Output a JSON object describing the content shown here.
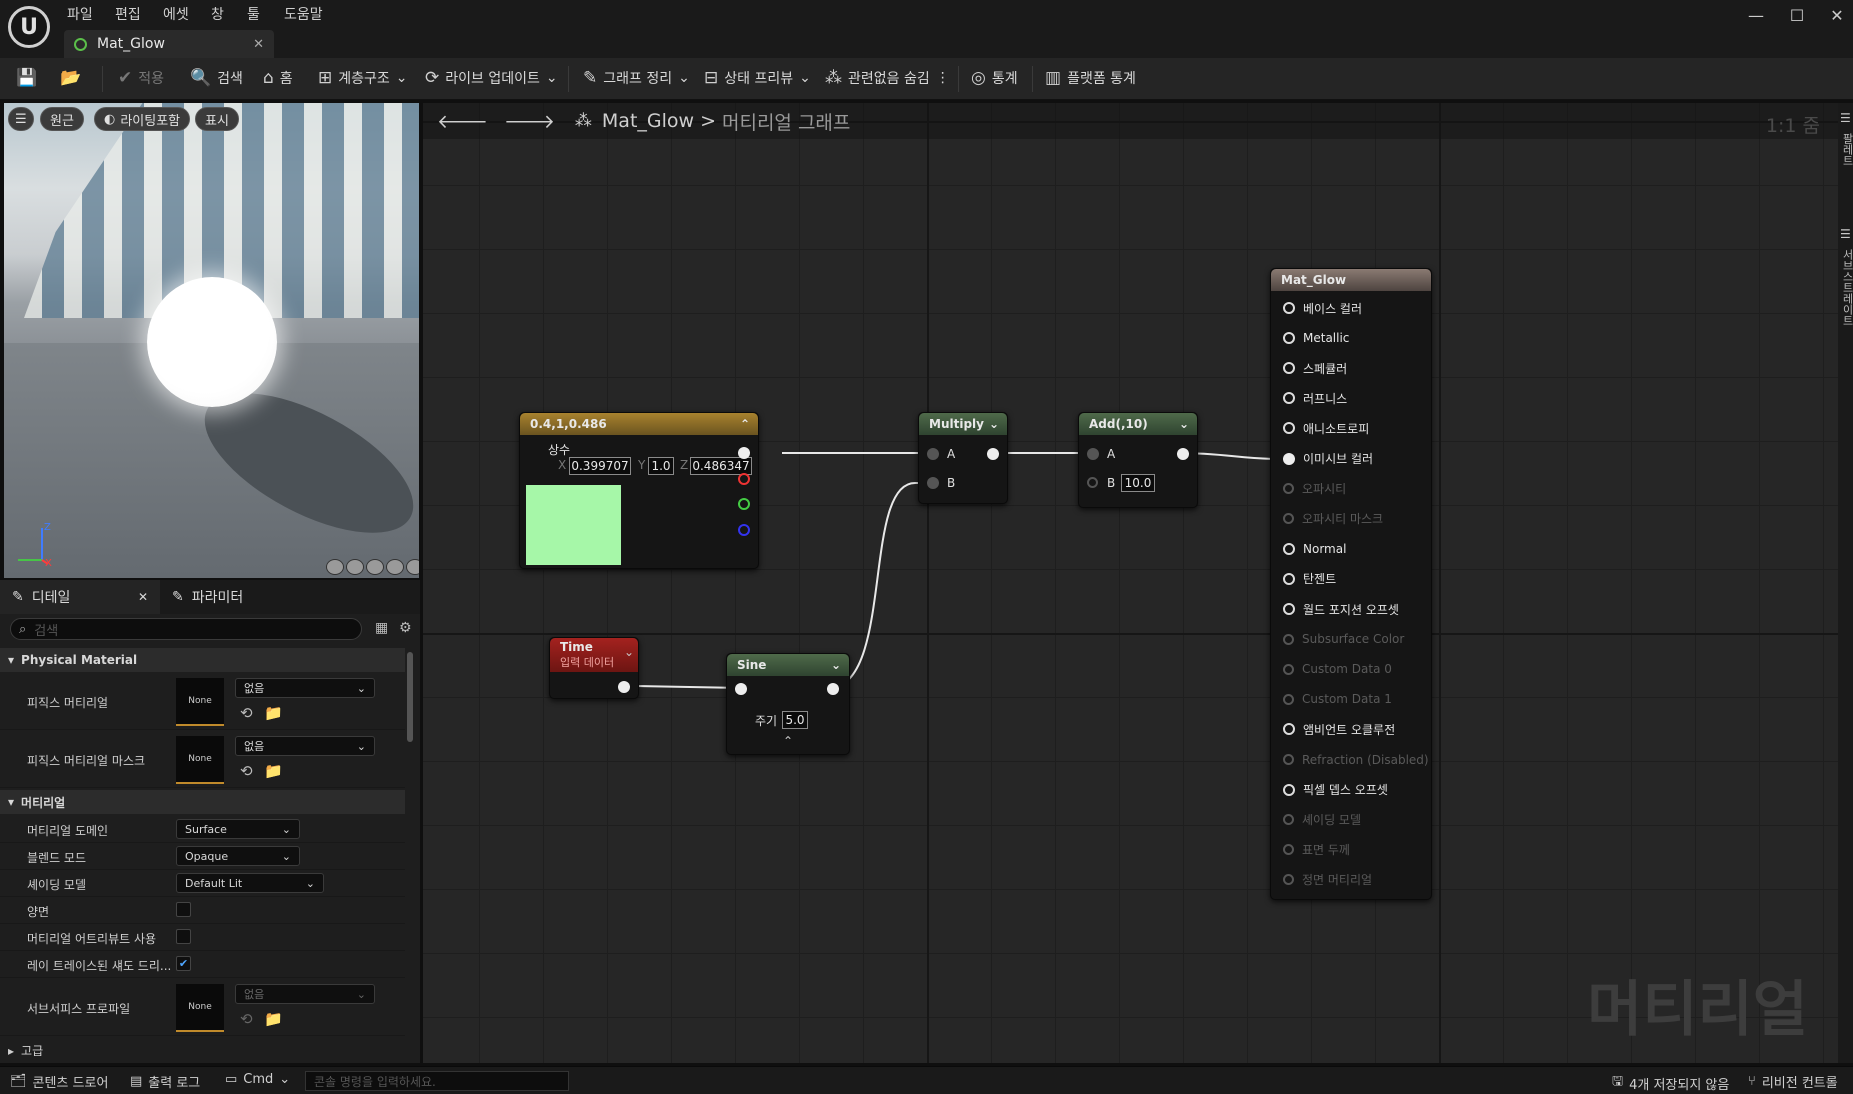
{
  "menu": [
    "파일",
    "편집",
    "에셋",
    "창",
    "툴",
    "도움말"
  ],
  "tab": {
    "title": "Mat_Glow"
  },
  "toolbar": {
    "apply": "적용",
    "search": "검색",
    "home": "홈",
    "hierarchy": "계층구조",
    "live_update": "라이브 업데이트",
    "graph_cleanup": "그래프 정리",
    "state_preview": "상태 프리뷰",
    "hide_unrelated": "관련없음 숨김",
    "stats": "통계",
    "platform_stats": "플랫폼 통계"
  },
  "viewport": {
    "perspective": "원근",
    "lighting": "라이팅포함",
    "show": "표시",
    "axis_z": "Z",
    "axis_x": "X"
  },
  "details": {
    "tab_details": "디테일",
    "tab_params": "파라미터",
    "search_placeholder": "검색",
    "section_physical": "Physical Material",
    "phys_material": "피직스 머티리얼",
    "phys_mask": "피직스 머티리얼 마스크",
    "none": "None",
    "none_kr": "없음",
    "section_material": "머티리얼",
    "domain_label": "머티리얼 도메인",
    "domain_value": "Surface",
    "blend_label": "블렌드 모드",
    "blend_value": "Opaque",
    "shading_label": "셰이딩 모델",
    "shading_value": "Default Lit",
    "twosided_label": "양면",
    "attrs_label": "머티리얼 어트리뷰트 사용",
    "raytrace_label": "레이 트레이스된 섀도 드리...",
    "subsurface_label": "서브서피스 프로파일",
    "advanced": "고급"
  },
  "graph": {
    "breadcrumb_asset": "Mat_Glow",
    "breadcrumb_sep": ">",
    "breadcrumb_graph": "머티리얼 그래프",
    "zoom": "1:1 줌",
    "watermark": "머티리얼",
    "const_node": {
      "title": "0.4,1,0.486",
      "label": "상수",
      "x_label": "X",
      "x": "0.399707",
      "y_label": "Y",
      "y": "1.0",
      "z_label": "Z",
      "z": "0.486347",
      "swatch": "#a6f7a8"
    },
    "time_node": {
      "title": "Time",
      "subtitle": "입력 데이터"
    },
    "sine_node": {
      "title": "Sine",
      "period_label": "주기",
      "period": "5.0"
    },
    "multiply_node": {
      "title": "Multiply",
      "a": "A",
      "b": "B"
    },
    "add_node": {
      "title": "Add(,10)",
      "a": "A",
      "b": "B",
      "b_value": "10.0"
    },
    "result_node": {
      "title": "Mat_Glow",
      "inputs": [
        {
          "label": "베이스 컬러",
          "enabled": true
        },
        {
          "label": "Metallic",
          "enabled": true
        },
        {
          "label": "스페큘러",
          "enabled": true
        },
        {
          "label": "러프니스",
          "enabled": true
        },
        {
          "label": "애니소트로피",
          "enabled": true
        },
        {
          "label": "이미시브 컬러",
          "enabled": true,
          "connected": true
        },
        {
          "label": "오파시티",
          "enabled": false
        },
        {
          "label": "오파시티 마스크",
          "enabled": false
        },
        {
          "label": "Normal",
          "enabled": true
        },
        {
          "label": "탄젠트",
          "enabled": true
        },
        {
          "label": "월드 포지션 오프셋",
          "enabled": true
        },
        {
          "label": "Subsurface Color",
          "enabled": false
        },
        {
          "label": "Custom Data 0",
          "enabled": false
        },
        {
          "label": "Custom Data 1",
          "enabled": false
        },
        {
          "label": "앰비언트 오클루전",
          "enabled": true
        },
        {
          "label": "Refraction (Disabled)",
          "enabled": false
        },
        {
          "label": "픽셀 뎁스 오프셋",
          "enabled": true
        },
        {
          "label": "셰이딩 모델",
          "enabled": false
        },
        {
          "label": "표면 두께",
          "enabled": false
        },
        {
          "label": "정면 머티리얼",
          "enabled": false
        }
      ]
    }
  },
  "right_strip": {
    "palette": "팔레트",
    "substrate": "서브스트레이트"
  },
  "statusbar": {
    "content_drawer": "콘텐츠 드로어",
    "output_log": "출력 로그",
    "cmd": "Cmd",
    "console_placeholder": "콘솔 명령을 입력하세요.",
    "unsaved": "4개 저장되지 않음",
    "revision": "리비전 컨트롤"
  }
}
